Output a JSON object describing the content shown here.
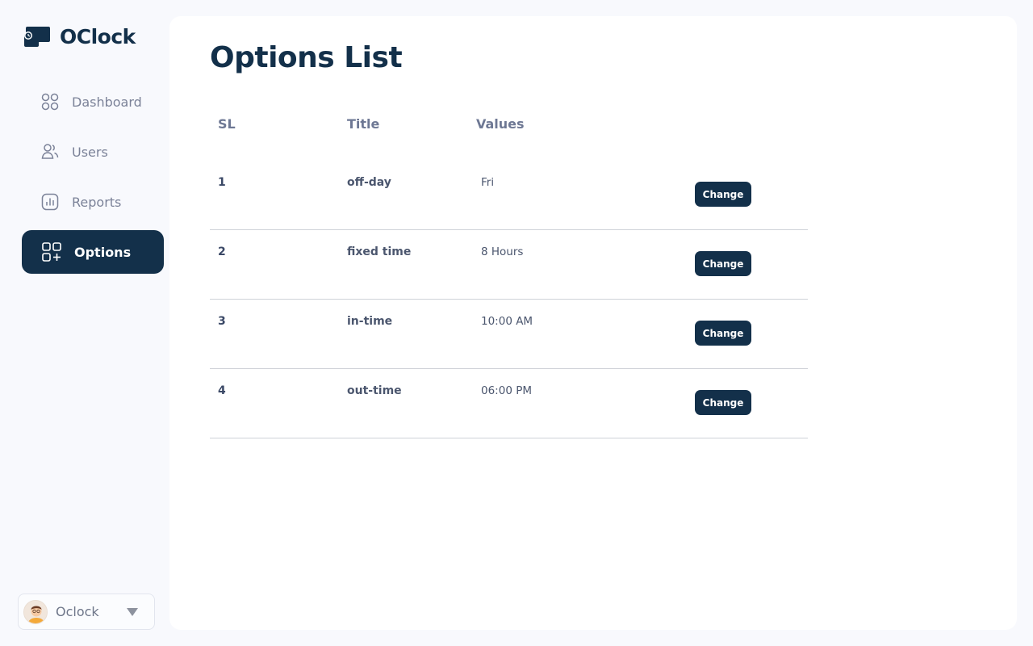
{
  "app": {
    "name": "OClock"
  },
  "sidebar": {
    "items": [
      {
        "label": "Dashboard",
        "icon": "grid-circles-icon",
        "active": false
      },
      {
        "label": "Users",
        "icon": "users-icon",
        "active": false
      },
      {
        "label": "Reports",
        "icon": "bar-chart-icon",
        "active": false
      },
      {
        "label": "Options",
        "icon": "grid-plus-icon",
        "active": true
      }
    ]
  },
  "user": {
    "name": "Oclock"
  },
  "page": {
    "title": "Options List"
  },
  "table": {
    "headers": {
      "sl": "SL",
      "title": "Title",
      "values": "Values"
    },
    "rows": [
      {
        "sl": "1",
        "title": "off-day",
        "value": "Fri",
        "action": "Change"
      },
      {
        "sl": "2",
        "title": "fixed time",
        "value": "8 Hours",
        "action": "Change"
      },
      {
        "sl": "3",
        "title": "in-time",
        "value": "10:00 AM",
        "action": "Change"
      },
      {
        "sl": "4",
        "title": "out-time",
        "value": "06:00 PM",
        "action": "Change"
      }
    ]
  },
  "colors": {
    "primary": "#13304a",
    "muted": "#7b8298",
    "background": "#f8f9fd"
  }
}
